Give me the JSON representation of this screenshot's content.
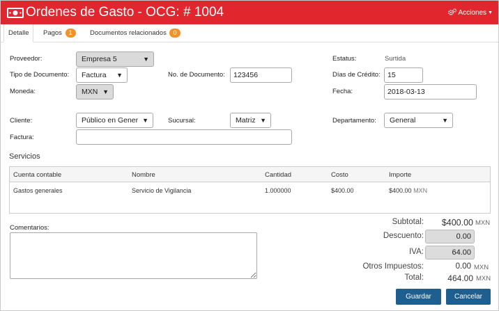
{
  "header": {
    "title": "Ordenes de Gasto - OCG: # 1004",
    "actions_label": "Acciones",
    "bg_color": "#e1262d"
  },
  "tabs": [
    {
      "label": "Detalle",
      "badge": ""
    },
    {
      "label": "Pagos",
      "badge": "1"
    },
    {
      "label": "Documentos relacionados",
      "badge": "0"
    }
  ],
  "form": {
    "proveedor": {
      "label": "Proveedor:",
      "value": "Empresa 5"
    },
    "tipo_documento": {
      "label": "Tipo de Documento:",
      "value": "Factura"
    },
    "moneda": {
      "label": "Moneda:",
      "value": "MXN"
    },
    "no_documento": {
      "label": "No. de Documento:",
      "value": "123456"
    },
    "estatus": {
      "label": "Estatus:",
      "value": "Surtida"
    },
    "dias_credito": {
      "label": "Días de Crédito:",
      "value": "15"
    },
    "fecha": {
      "label": "Fecha:",
      "value": "2018-03-13"
    },
    "cliente": {
      "label": "Cliente:",
      "value": "Público en Gener"
    },
    "sucursal": {
      "label": "Sucursal:",
      "value": "Matriz"
    },
    "departamento": {
      "label": "Departamento:",
      "value": "General"
    },
    "factura": {
      "label": "Factura:",
      "value": ""
    }
  },
  "servicios": {
    "title": "Servicios",
    "columns": [
      "Cuenta contable",
      "Nombre",
      "Cantidad",
      "Costo",
      "Importe"
    ],
    "rows": [
      {
        "cuenta": "Gastos generales",
        "nombre": "Servicio de Vigilancia",
        "cantidad": "1.000000",
        "costo": "$400.00",
        "importe": "$400.00",
        "moneda": "MXN"
      }
    ]
  },
  "comentarios": {
    "label": "Comentarios:",
    "value": ""
  },
  "totales": {
    "subtotal_label": "Subtotal:",
    "subtotal": "$400.00",
    "descuento_label": "Descuento:",
    "descuento": "0.00",
    "iva_label": "IVA:",
    "iva": "64.00",
    "otros_label": "Otros Impuestos:",
    "otros": "0.00",
    "total_label": "Total:",
    "total": "464.00",
    "currency": "MXN"
  },
  "buttons": {
    "guardar": "Guardar",
    "cancelar": "Cancelar",
    "color": "#1f5f8f"
  }
}
